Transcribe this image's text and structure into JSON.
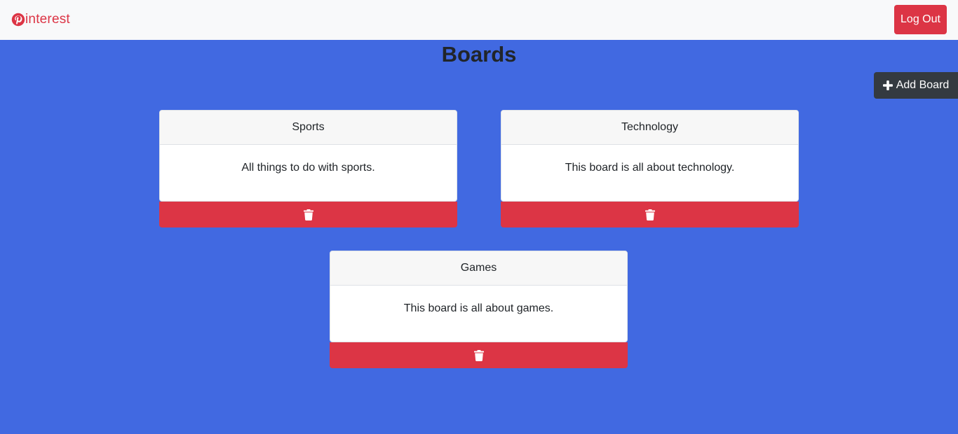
{
  "navbar": {
    "brand_text": "interest",
    "logout_label": "Log Out"
  },
  "main": {
    "title": "Boards",
    "add_board_label": "Add Board",
    "boards": [
      {
        "name": "Sports",
        "description": "All things to do with sports."
      },
      {
        "name": "Technology",
        "description": "This board is all about technology."
      },
      {
        "name": "Games",
        "description": "This board is all about games."
      }
    ]
  },
  "colors": {
    "background": "#4169e1",
    "navbar": "#f8f9fa",
    "danger": "#dc3545",
    "dark": "#343a40"
  },
  "icons": [
    "pinterest-logo-icon",
    "plus-icon",
    "trash-icon"
  ]
}
